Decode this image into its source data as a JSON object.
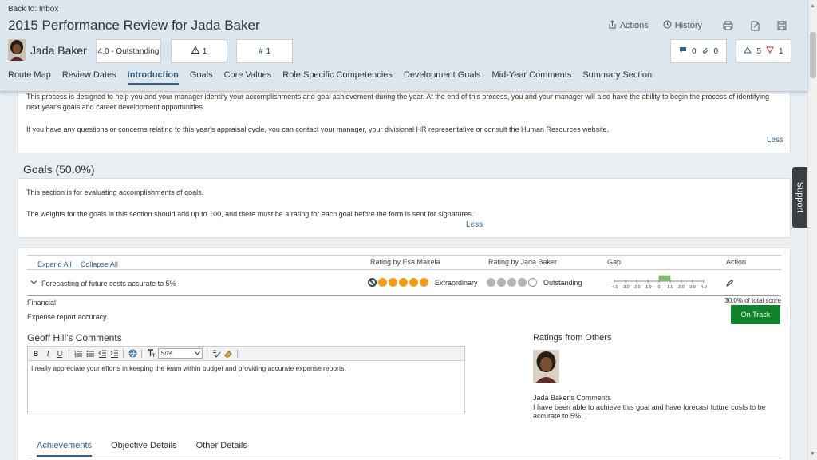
{
  "header": {
    "back_link": "Back to: Inbox",
    "title": "2015 Performance Review for Jada Baker",
    "actions_label": "Actions",
    "history_label": "History",
    "employee_name": "Jada Baker",
    "rating_box": "4.0 - Outstanding",
    "warn_count": "1",
    "hash_count": "1",
    "comment_count": "0",
    "attach_count": "0",
    "up_count": "5",
    "down_count": "1"
  },
  "tabs": [
    "Route Map",
    "Review Dates",
    "Introduction",
    "Goals",
    "Core Values",
    "Role Specific Competencies",
    "Development Goals",
    "Mid-Year Comments",
    "Summary Section"
  ],
  "intro": {
    "para1_line1": "This process is designed to help you and your manager identify your accomplishments and goal achievement during the year. At the end of this process, you and your manager will also have the ability to begin the process of identifying",
    "para1_line2": "next year's goals and career development opportunities.",
    "para2": "If you have any questions or concerns relating to this year's appraisal cycle, you can contact your manager, your divisional HR representative or consult the Human Resources website.",
    "less": "Less"
  },
  "goals": {
    "title": "Goals (50.0%)",
    "desc1": "This section is for evaluating accomplishments of goals.",
    "desc2": "The weights for the goals in this section should add up to 100, and there must be a rating for each goal before the form is sent for signatures.",
    "less": "Less"
  },
  "goal_table": {
    "expand_all": "Expand All",
    "collapse_all": "Collapse All",
    "col_rating_esa": "Rating by Esa Makela",
    "col_rating_jada": "Rating by Jada Baker",
    "col_gap": "Gap",
    "col_action": "Action",
    "goal_name": "Forecasting of future costs accurate to 5%",
    "esa_rating_label": "Extraordinary",
    "esa_rating_value": 5,
    "jada_rating_label": "Outstanding",
    "jada_rating_value": 4,
    "gap_ticks": [
      "-4.0",
      "-3.0",
      "-2.0",
      "-1.0",
      "0",
      "1.0",
      "2.0",
      "3.0",
      "4.0"
    ],
    "gap_value": 1.0,
    "category": "Financial",
    "score_share": "30.0% of total score",
    "metric": "Expense report accuracy",
    "status": "On Track"
  },
  "comments": {
    "title": "Geoff Hill's Comments",
    "size_select": "Size",
    "text": "I really appreciate your efforts in keeping the team within budget and providing accurate expense reports."
  },
  "others": {
    "title": "Ratings from Others",
    "name": "Jada Baker's Comments",
    "text_line1": "I have been able to achieve this goal and have forecast future costs to be",
    "text_line2": "accurate to 5%."
  },
  "bottom_tabs": [
    "Achievements",
    "Objective Details",
    "Other Details"
  ],
  "support": "Support",
  "colors": {
    "accent": "#346187",
    "on_track": "#10822c",
    "rating_dot": "#f29d1e"
  }
}
